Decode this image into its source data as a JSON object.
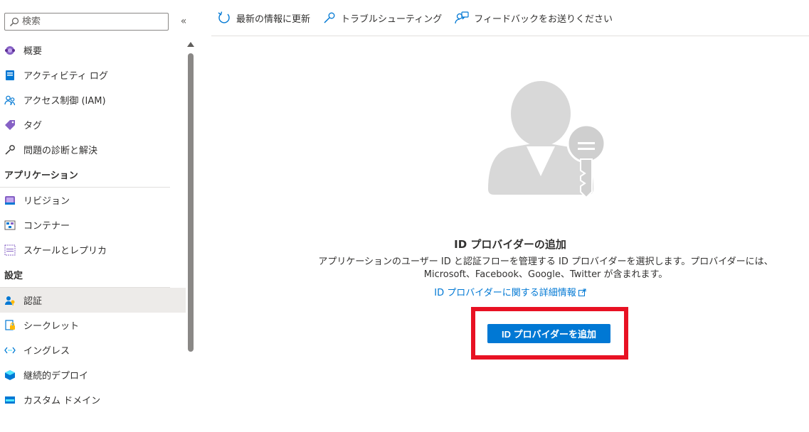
{
  "sidebar": {
    "search_placeholder": "検索",
    "collapse_glyph": "«",
    "items": [
      {
        "label": "概要",
        "icon": "overview-icon"
      },
      {
        "label": "アクティビティ ログ",
        "icon": "activity-log-icon"
      },
      {
        "label": "アクセス制御 (IAM)",
        "icon": "access-control-icon"
      },
      {
        "label": "タグ",
        "icon": "tag-icon"
      },
      {
        "label": "問題の診断と解決",
        "icon": "wrench-icon"
      }
    ],
    "section_app": "アプリケーション",
    "app_items": [
      {
        "label": "リビジョン",
        "icon": "revision-icon"
      },
      {
        "label": "コンテナー",
        "icon": "container-icon"
      },
      {
        "label": "スケールとレプリカ",
        "icon": "scale-icon"
      }
    ],
    "section_settings": "設定",
    "settings_items": [
      {
        "label": "認証",
        "icon": "authentication-icon",
        "selected": true
      },
      {
        "label": "シークレット",
        "icon": "secret-icon"
      },
      {
        "label": "イングレス",
        "icon": "ingress-icon"
      },
      {
        "label": "継続的デプロイ",
        "icon": "continuous-deploy-icon"
      },
      {
        "label": "カスタム ドメイン",
        "icon": "custom-domain-icon"
      }
    ]
  },
  "toolbar": {
    "refresh_label": "最新の情報に更新",
    "troubleshoot_label": "トラブルシューティング",
    "feedback_label": "フィードバックをお送りください"
  },
  "content": {
    "title": "ID プロバイダーの追加",
    "description": "アプリケーションのユーザー ID と認証フローを管理する ID プロバイダーを選択します。プロバイダーには、Microsoft、Facebook、Google、Twitter が含まれます。",
    "learn_more": "ID プロバイダーに関する詳細情報",
    "add_button": "ID プロバイダーを追加"
  },
  "colors": {
    "accent": "#0078d4",
    "highlight": "#e81123",
    "selected_bg": "#edebe9"
  }
}
